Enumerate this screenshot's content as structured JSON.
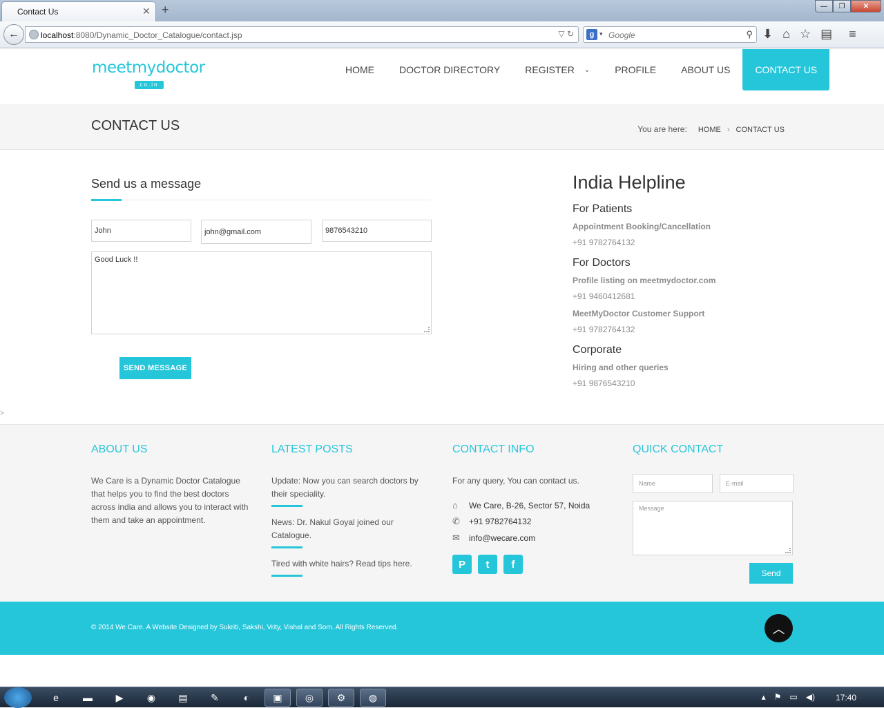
{
  "browser": {
    "tab_title": "Contact Us",
    "url_host": "localhost",
    "url_rest": ":8080/Dynamic_Doctor_Catalogue/contact.jsp",
    "search_engine": "g-icon",
    "search_placeholder": "Google"
  },
  "nav": {
    "items": [
      {
        "label": "HOME"
      },
      {
        "label": "DOCTOR DIRECTORY"
      },
      {
        "label": "REGISTER"
      },
      {
        "label": "PROFILE"
      },
      {
        "label": "ABOUT US"
      },
      {
        "label": "CONTACT US"
      }
    ],
    "active_index": 5
  },
  "logo": {
    "text": "meetmydoctor",
    "sub": "co.in"
  },
  "page": {
    "title": "CONTACT US",
    "breadcrumb_label": "You are here:",
    "breadcrumb_home": "HOME",
    "breadcrumb_sep": "›",
    "breadcrumb_current": "CONTACT US"
  },
  "form": {
    "title": "Send us a message",
    "name_value": "John",
    "email_value": "john@gmail.com",
    "phone_value": "9876543210",
    "message_value": "Good Luck !!",
    "submit_label": "SEND MESSAGE"
  },
  "helpline": {
    "title": "India Helpline",
    "patients_heading": "For Patients",
    "patients_desc": "Appointment Booking/Cancellation",
    "patients_phone": "+91 9782764132",
    "doctors_heading": "For Doctors",
    "doctors_desc": "Profile listing on meetmydoctor.com",
    "doctors_phone": "+91 9460412681",
    "support_desc": "MeetMyDoctor Customer Support",
    "support_phone": "+91 9782764132",
    "corporate_heading": "Corporate",
    "corporate_desc": "Hiring and other queries",
    "corporate_phone": "+91 9876543210"
  },
  "stray_text": ">",
  "footer": {
    "about_title": "ABOUT US",
    "about_text": "We Care is a Dynamic Doctor Catalogue that helps you to find the best doctors across india and allows you to interact with them and take an appointment.",
    "posts_title": "LATEST POSTS",
    "posts": [
      {
        "text": "Update: Now you can search doctors by their speciality."
      },
      {
        "text": "News: Dr. Nakul Goyal joined our Catalogue."
      },
      {
        "text": "Tired with white hairs? Read tips here."
      }
    ],
    "contact_title": "CONTACT INFO",
    "contact_intro": "For any query, You can contact us.",
    "address": "We Care, B-26, Sector 57, Noida",
    "phone": "+91 9782764132",
    "email": "info@wecare.com",
    "quick_title": "QUICK CONTACT",
    "qc_name_ph": "Name",
    "qc_email_ph": "E-mail",
    "qc_message_ph": "Message",
    "qc_send": "Send",
    "copyright": "© 2014 We Care. A Website Designed by Sukriti, Sakshi, Vrity, Vishal and Som. All Rights Reserved."
  },
  "taskbar": {
    "clock": "17:40"
  },
  "colors": {
    "accent": "#26c6da"
  }
}
